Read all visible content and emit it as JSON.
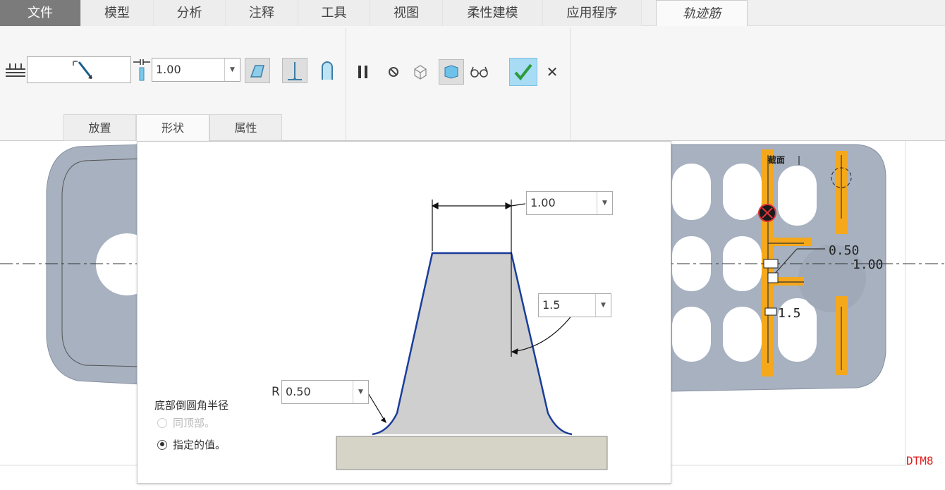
{
  "tabs": [
    {
      "label": "文件"
    },
    {
      "label": "模型"
    },
    {
      "label": "分析"
    },
    {
      "label": "注释"
    },
    {
      "label": "工具"
    },
    {
      "label": "视图"
    },
    {
      "label": "柔性建模"
    },
    {
      "label": "应用程序"
    },
    {
      "label": "轨迹筋"
    }
  ],
  "toolbar": {
    "thickness_value": "1.00"
  },
  "subtabs": [
    {
      "label": "放置"
    },
    {
      "label": "形状"
    },
    {
      "label": "属性"
    }
  ],
  "shape_panel": {
    "top_width": "1.00",
    "draft_angle": "1.5",
    "radius_prefix": "R",
    "bottom_radius": "0.50",
    "bottom_radius_label": "底部倒圆角半径",
    "option_same_as_top": "同顶部。",
    "option_specified": "指定的值。",
    "selected_option": "指定的值。"
  },
  "viewport": {
    "section_label": "截面",
    "dim_1": "0.50",
    "dim_2": "1.00",
    "dim_3": "1.5",
    "datum_label": "DTM8"
  },
  "colors": {
    "rib_highlight": "#f5a81c",
    "model": "#a7b1c0",
    "profile_line": "#1a3d9a"
  }
}
